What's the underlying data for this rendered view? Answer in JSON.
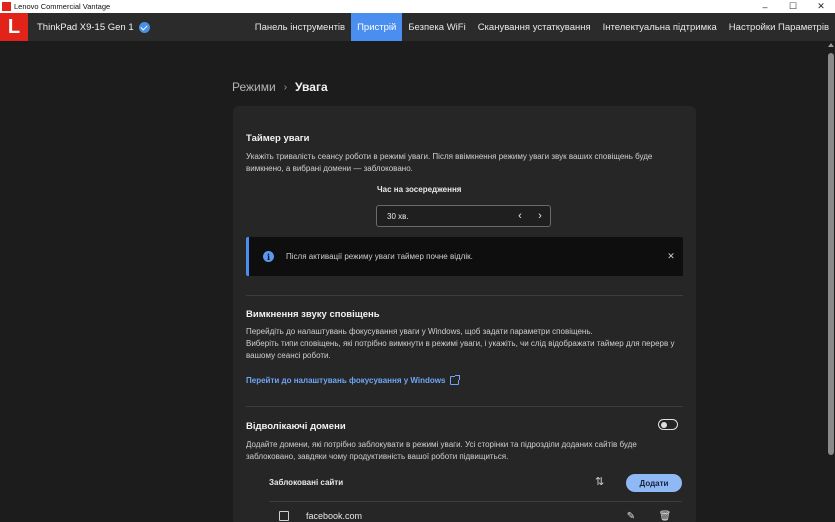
{
  "window": {
    "title": "Lenovo Commercial Vantage",
    "minimize": "–",
    "maximize": "☐",
    "close": "✕"
  },
  "header": {
    "logo": "L",
    "device": "ThinkPad X9-15 Gen 1",
    "nav": [
      {
        "label": "Панель інструментів",
        "active": false
      },
      {
        "label": "Пристрій",
        "active": true
      },
      {
        "label": "Безпека WiFi",
        "active": false
      },
      {
        "label": "Сканування устаткування",
        "active": false
      },
      {
        "label": "Інтелектуальна підтримка",
        "active": false
      },
      {
        "label": "Настройки Параметрів",
        "active": false
      }
    ]
  },
  "breadcrumb": {
    "parent": "Режими",
    "separator": "›",
    "current": "Увага"
  },
  "timer": {
    "title": "Таймер уваги",
    "desc_line1": "Укажіть тривалість сеансу роботи в режимі уваги. Після ввімкнення режиму уваги звук ваших сповіщень буде",
    "desc_line2": "вимкнено, а вибрані домени — заблоковано.",
    "focus_label": "Час на зосередження",
    "focus_value": "30 хв.",
    "prev": "‹",
    "next": "›",
    "banner_msg": "Після активації режиму уваги таймер почне відлік.",
    "banner_icon": "i",
    "banner_close": "✕"
  },
  "mute": {
    "title": "Вимкнення звуку сповіщень",
    "line1": "Перейдіть до налаштувань фокусування уваги у Windows, щоб задати параметри сповіщень.",
    "line2": "Виберіть типи сповіщень, які потрібно вимкнути в режимі уваги, і укажіть, чи слід відображати таймер для перерв у",
    "line3": "вашому сеансі роботи.",
    "link": "Перейти до налаштувань фокусування у Windows"
  },
  "domains": {
    "title": "Відволікаючі домени",
    "toggle_on": false,
    "line1": "Додайте домени, які потрібно заблокувати в режимі уваги. Усі сторінки та підрозділи доданих сайтів буде",
    "line2": "заблоковано, завдяки чому продуктивність вашої роботи підвищиться.",
    "blocked_header": "Заблоковані сайти",
    "add_label": "Додати",
    "sort_icon": "⇅",
    "sites": [
      {
        "name": "facebook.com",
        "edit": "✎",
        "delete": "🗑"
      }
    ]
  }
}
